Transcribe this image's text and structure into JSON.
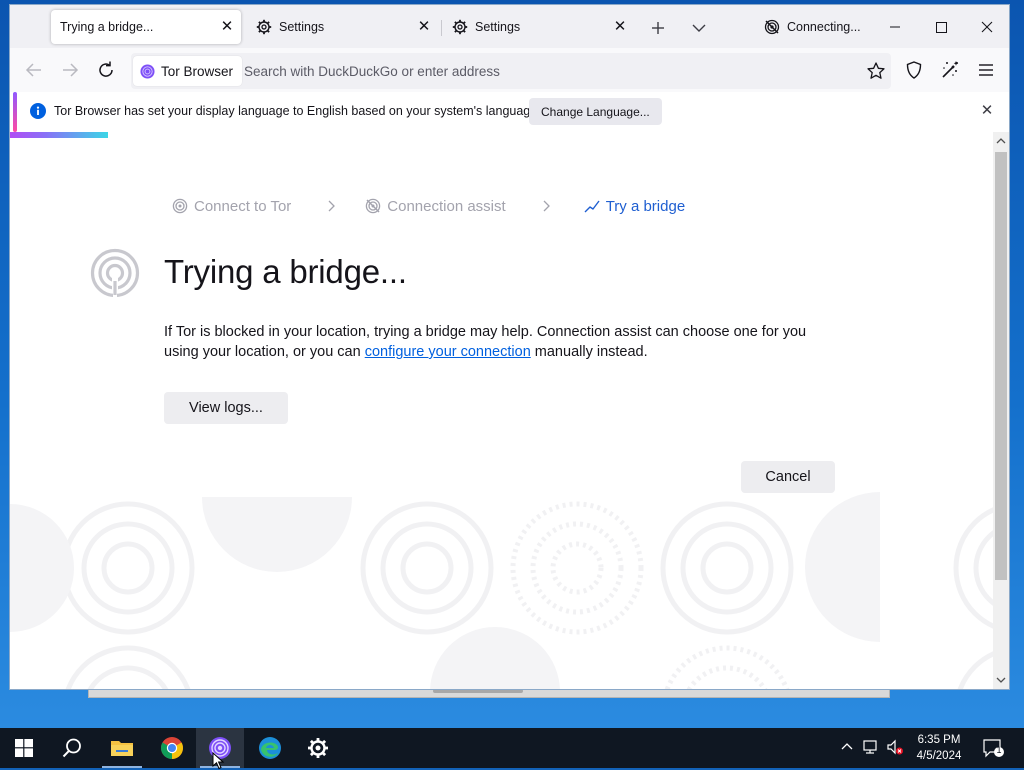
{
  "tabs": [
    {
      "title": "Trying a bridge...",
      "active": true
    },
    {
      "title": "Settings",
      "active": false
    },
    {
      "title": "Settings",
      "active": false
    }
  ],
  "tor_status": "Connecting...",
  "identity_label": "Tor Browser",
  "search_placeholder": "Search with DuckDuckGo or enter address",
  "notification": {
    "message": "Tor Browser has set your display language to English based on your system's language.",
    "button": "Change Language..."
  },
  "breadcrumb": {
    "step1": "Connect to Tor",
    "step2": "Connection assist",
    "step3": "Try a bridge"
  },
  "page": {
    "title": "Trying a bridge...",
    "desc_before": "If Tor is blocked in your location, trying a bridge may help. Connection assist can choose one for you using your location, or you can ",
    "desc_link": "configure your connection",
    "desc_after": " manually instead.",
    "view_logs": "View logs...",
    "cancel": "Cancel"
  },
  "taskbar": {
    "time": "6:35 PM",
    "date": "4/5/2024",
    "notification_count": "1"
  },
  "colors": {
    "accent_blue": "#1f5fd1",
    "link": "#0060df",
    "tor_purple": "#7d4ff7"
  },
  "icons": [
    "gear-icon",
    "close-icon",
    "plus-icon",
    "chevron-down-icon",
    "tor-onion-icon",
    "back-arrow-icon",
    "forward-arrow-icon",
    "reload-icon",
    "star-icon",
    "shield-icon",
    "new-identity-icon",
    "hamburger-menu-icon",
    "info-icon",
    "windows-start-icon",
    "search-icon",
    "file-explorer-icon",
    "chrome-icon",
    "edge-icon",
    "settings-icon"
  ]
}
